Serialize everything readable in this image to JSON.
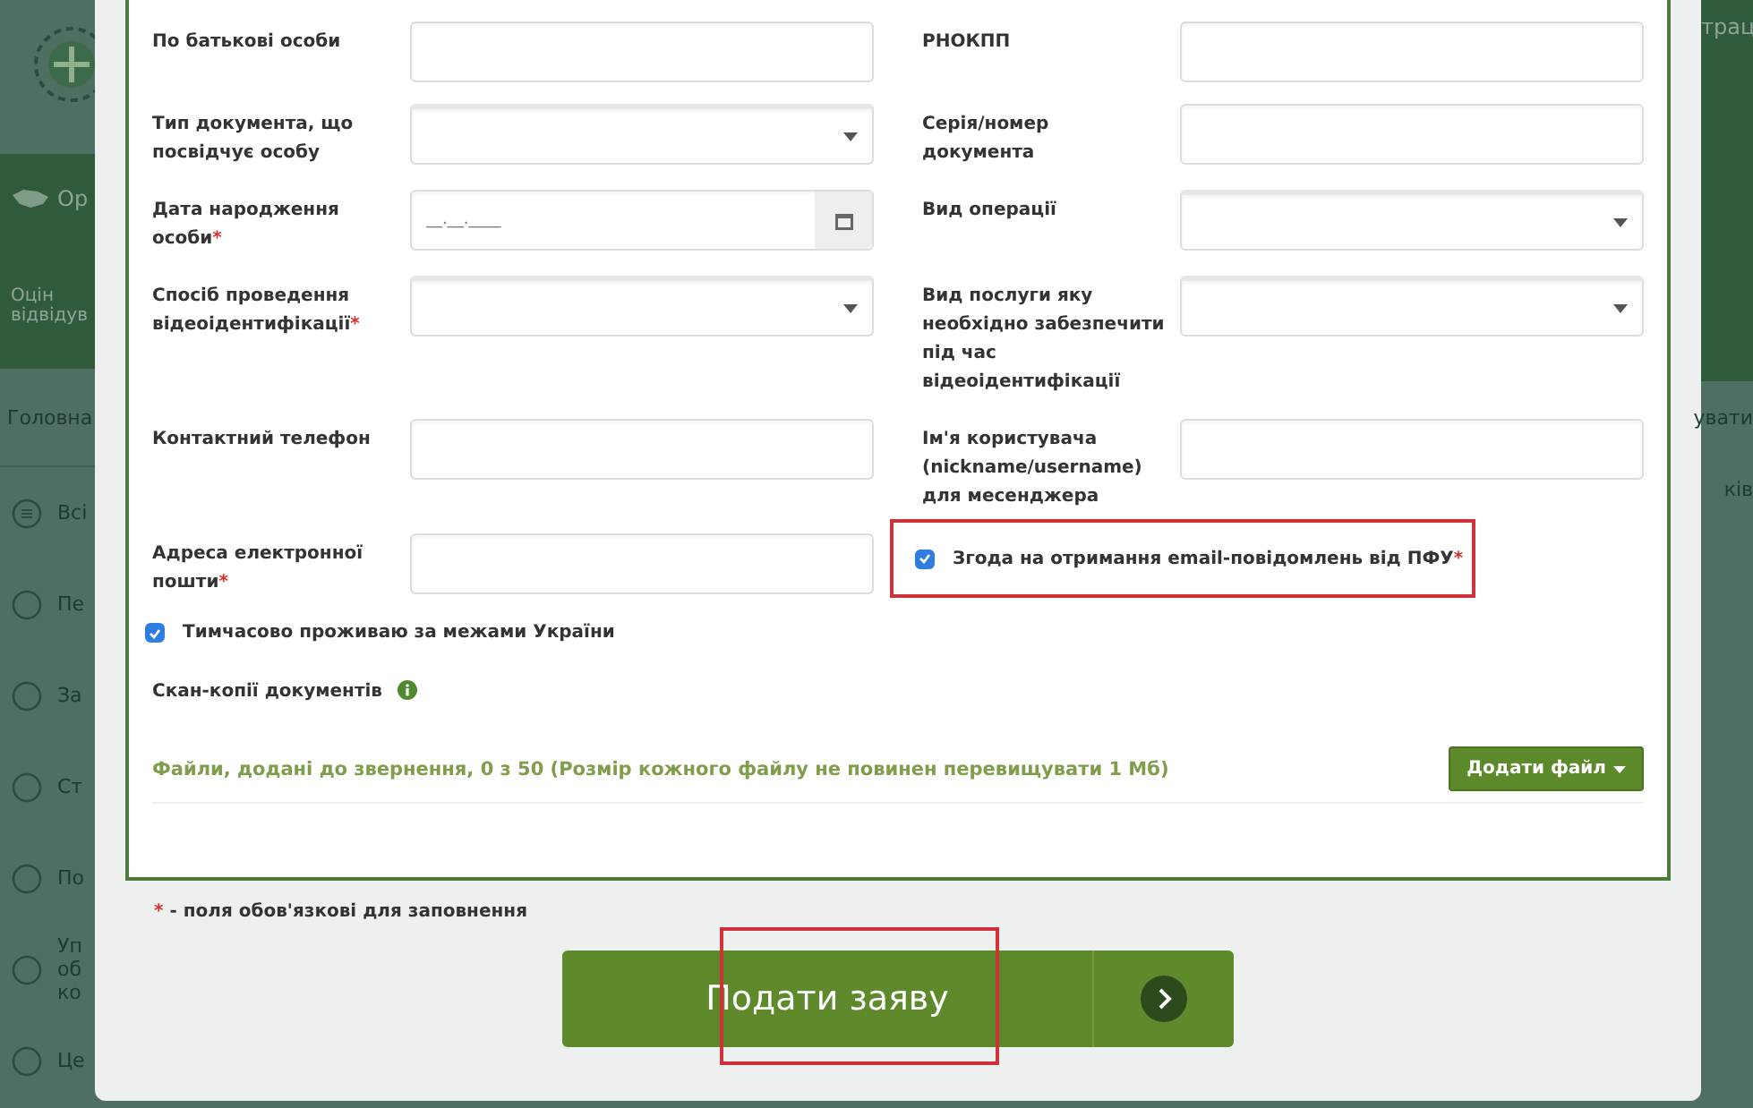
{
  "background_page": {
    "left_items": [
      {
        "kind": "logo"
      },
      {
        "kind": "band",
        "text": "Ор"
      },
      {
        "kind": "band2",
        "lines": [
          "Оцін",
          "відвідув"
        ]
      },
      {
        "kind": "link",
        "text": "Головна"
      },
      {
        "kind": "item",
        "lines": [
          "Всі"
        ]
      },
      {
        "kind": "item",
        "lines": [
          "Пе"
        ]
      },
      {
        "kind": "item",
        "lines": [
          "За"
        ]
      },
      {
        "kind": "item",
        "lines": [
          "Ст"
        ]
      },
      {
        "kind": "item",
        "lines": [
          "По"
        ]
      },
      {
        "kind": "item",
        "lines": [
          "Уп",
          "об",
          "ко"
        ]
      },
      {
        "kind": "item",
        "lines": [
          "Це"
        ]
      }
    ],
    "right_items": [
      {
        "kind": "header",
        "text": "трац"
      },
      {
        "kind": "link",
        "text": "увати"
      },
      {
        "kind": "item",
        "text": "ків"
      }
    ]
  },
  "form": {
    "rows": [
      {
        "left": {
          "kind": "text",
          "label": "По батькові особи"
        },
        "right": {
          "kind": "text",
          "label": "РНОКПП"
        }
      },
      {
        "left": {
          "kind": "select",
          "label": "Тип документа, що посвідчує особу"
        },
        "right": {
          "kind": "text",
          "label": "Серія/номер документа"
        }
      },
      {
        "left": {
          "kind": "date",
          "label": "Дата народження особи",
          "mark": "*",
          "placeholder": "__.__.____"
        },
        "right": {
          "kind": "select",
          "label": "Вид операції"
        }
      },
      {
        "left": {
          "kind": "select",
          "label": "Спосіб проведення відеоідентифікації",
          "mark": "*"
        },
        "right": {
          "kind": "select",
          "label": "Вид послуги яку необхідно забезпечити під час відеоідентифікації"
        }
      },
      {
        "left": {
          "kind": "text",
          "label": "Контактний телефон"
        },
        "right": {
          "kind": "text",
          "label": "Ім'я користувача (nickname/username) для месенджера"
        }
      },
      {
        "left": {
          "kind": "text",
          "label": "Адреса електронної пошти",
          "mark": "*"
        },
        "right": {
          "kind": "checkbox",
          "label": "Згода на отримання email-повідомлень від ПФУ",
          "mark": "*",
          "checked": true,
          "highlighted": true
        }
      }
    ],
    "abroad": {
      "label": "Тимчасово проживаю за межами України",
      "checked": true
    },
    "scans": {
      "label": "Скан-копії документів"
    },
    "files_note": "Файли, додані до звернення, 0 з 50 (Розмір кожного файлу не повинен перевищувати 1 Мб)",
    "add_file_button": "Додати файл"
  },
  "required_note": {
    "mark": "*",
    "text": " - поля обов'язкові для заповнення"
  },
  "submit": {
    "label": "Подати заяву",
    "highlighted": true
  }
}
